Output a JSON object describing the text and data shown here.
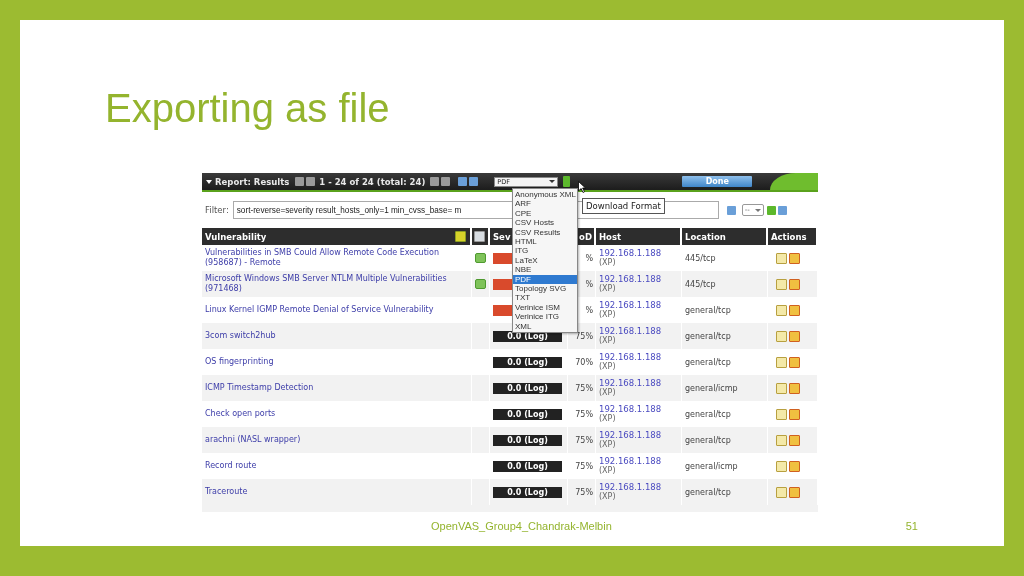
{
  "slide": {
    "title": "Exporting as file",
    "footer": "OpenVAS_Group4_Chandrak-Melbin",
    "page_number": "51"
  },
  "toolbar": {
    "title": "Report: Results",
    "range": "1 - 24 of 24 (total: 24)",
    "format_select": "PDF",
    "done_button": "Done"
  },
  "filter": {
    "label": "Filter:",
    "value": "sort-reverse=severity result_hosts_only=1 min_cvss_base= m",
    "select": "--"
  },
  "format_menu": {
    "tooltip": "Download Format",
    "options": [
      {
        "label": "Anonymous XML",
        "selected": false
      },
      {
        "label": "ARF",
        "selected": false
      },
      {
        "label": "CPE",
        "selected": false
      },
      {
        "label": "CSV Hosts",
        "selected": false
      },
      {
        "label": "CSV Results",
        "selected": false
      },
      {
        "label": "HTML",
        "selected": false
      },
      {
        "label": "ITG",
        "selected": false
      },
      {
        "label": "LaTeX",
        "selected": false
      },
      {
        "label": "NBE",
        "selected": false
      },
      {
        "label": "PDF",
        "selected": true
      },
      {
        "label": "Topology SVG",
        "selected": false
      },
      {
        "label": "TXT",
        "selected": false
      },
      {
        "label": "Verinice ISM",
        "selected": false
      },
      {
        "label": "Verinice ITG",
        "selected": false
      },
      {
        "label": "XML",
        "selected": false
      }
    ]
  },
  "table": {
    "columns": [
      "Vulnerability",
      "Sev",
      "oD",
      "Host",
      "Location",
      "Actions"
    ],
    "rows": [
      {
        "vulnerability": "Vulnerabilities in SMB Could Allow Remote Code Execution (958687) - Remote",
        "note": true,
        "severity": {
          "kind": "high"
        },
        "qod": "%",
        "host": "192.168.1.188",
        "os": "(XP)",
        "location": "445/tcp"
      },
      {
        "vulnerability": "Microsoft Windows SMB Server NTLM Multiple Vulnerabilities (971468)",
        "note": true,
        "severity": {
          "kind": "high"
        },
        "qod": "%",
        "host": "192.168.1.188",
        "os": "(XP)",
        "location": "445/tcp"
      },
      {
        "vulnerability": "Linux Kernel IGMP Remote Denial of Service Vulnerability",
        "note": false,
        "severity": {
          "kind": "high"
        },
        "qod": "%",
        "host": "192.168.1.188",
        "os": "(XP)",
        "location": "general/tcp"
      },
      {
        "vulnerability": "3com switch2hub",
        "note": false,
        "severity": {
          "kind": "log",
          "label": "0.0 (Log)"
        },
        "qod": "75%",
        "host": "192.168.1.188",
        "os": "(XP)",
        "location": "general/tcp"
      },
      {
        "vulnerability": "OS fingerprinting",
        "note": false,
        "severity": {
          "kind": "log",
          "label": "0.0 (Log)"
        },
        "qod": "70%",
        "host": "192.168.1.188",
        "os": "(XP)",
        "location": "general/tcp"
      },
      {
        "vulnerability": "ICMP Timestamp Detection",
        "note": false,
        "severity": {
          "kind": "log",
          "label": "0.0 (Log)"
        },
        "qod": "75%",
        "host": "192.168.1.188",
        "os": "(XP)",
        "location": "general/icmp"
      },
      {
        "vulnerability": "Check open ports",
        "note": false,
        "severity": {
          "kind": "log",
          "label": "0.0 (Log)"
        },
        "qod": "75%",
        "host": "192.168.1.188",
        "os": "(XP)",
        "location": "general/tcp"
      },
      {
        "vulnerability": "arachni (NASL wrapper)",
        "note": false,
        "severity": {
          "kind": "log",
          "label": "0.0 (Log)"
        },
        "qod": "75%",
        "host": "192.168.1.188",
        "os": "(XP)",
        "location": "general/tcp"
      },
      {
        "vulnerability": "Record route",
        "note": false,
        "severity": {
          "kind": "log",
          "label": "0.0 (Log)"
        },
        "qod": "75%",
        "host": "192.168.1.188",
        "os": "(XP)",
        "location": "general/icmp"
      },
      {
        "vulnerability": "Traceroute",
        "note": false,
        "severity": {
          "kind": "log",
          "label": "0.0 (Log)"
        },
        "qod": "75%",
        "host": "192.168.1.188",
        "os": "(XP)",
        "location": "general/tcp"
      }
    ]
  }
}
